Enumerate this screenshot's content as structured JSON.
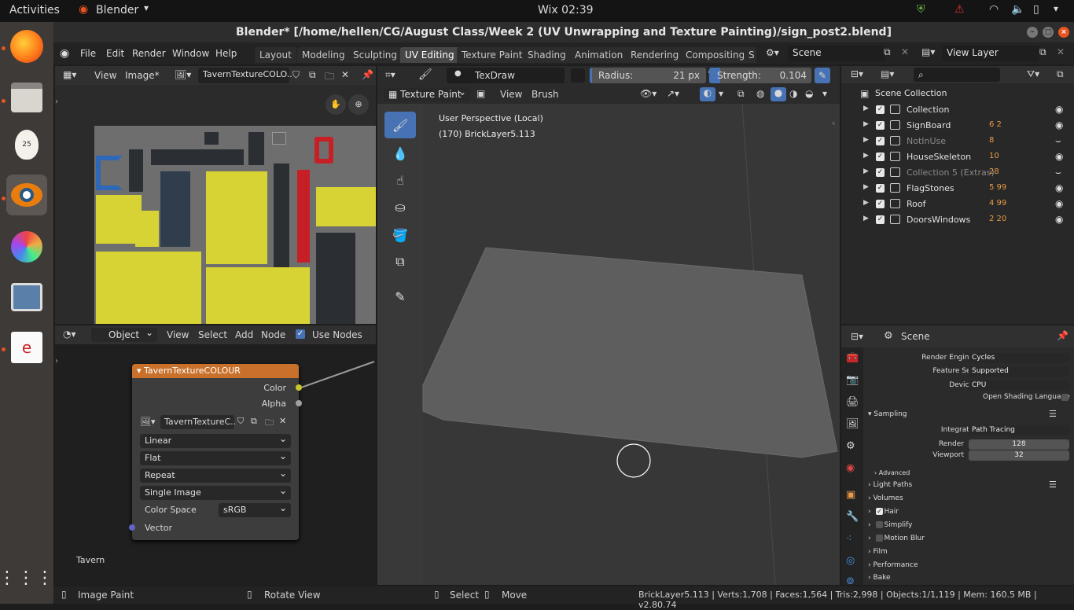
{
  "system": {
    "activities": "Activities",
    "app_menu": "Blender",
    "clock": "Wix 02:39"
  },
  "window": {
    "title": "Blender* [/home/hellen/CG/August Class/Week 2 (UV Unwrapping and Texture Painting)/sign_post2.blend]"
  },
  "menu": [
    "File",
    "Edit",
    "Render",
    "Window",
    "Help"
  ],
  "workspaces": [
    "Layout",
    "Modeling",
    "Sculpting",
    "UV Editing",
    "Texture Paint",
    "Shading",
    "Animation",
    "Rendering",
    "Compositing",
    "S"
  ],
  "active_workspace": "UV Editing",
  "scene": {
    "label": "Scene",
    "view_layer": "View Layer"
  },
  "image_editor": {
    "view": "View",
    "image": "Image*",
    "image_name": "TavernTextureCOLO.."
  },
  "node_editor": {
    "mode": "Object",
    "view": "View",
    "select": "Select",
    "add": "Add",
    "node": "Node",
    "use_nodes": "Use Nodes",
    "frame_label": "Tavern",
    "node_title": "TavernTextureCOLOUR",
    "out_color": "Color",
    "out_alpha": "Alpha",
    "image_field": "TavernTextureC..",
    "interpolation": "Linear",
    "projection": "Flat",
    "extension": "Repeat",
    "source": "Single Image",
    "color_space_label": "Color Space",
    "color_space": "sRGB",
    "in_vector": "Vector"
  },
  "viewport": {
    "brush_name": "TexDraw",
    "radius_label": "Radius:",
    "radius_value": "21 px",
    "strength_label": "Strength:",
    "strength_value": "0.104",
    "strength_fraction": 0.104,
    "mode": "Texture Paint",
    "view": "View",
    "brush": "Brush",
    "overlay_line1": "User Perspective (Local)",
    "overlay_line2": "(170) BrickLayer5.113"
  },
  "outliner": {
    "root": "Scene Collection",
    "items": [
      {
        "name": "Collection",
        "counts": "",
        "dim": false
      },
      {
        "name": "SignBoard",
        "counts": "6 2",
        "dim": false
      },
      {
        "name": "NotInUse",
        "counts": "8",
        "dim": true
      },
      {
        "name": "HouseSkeleton",
        "counts": "10",
        "dim": false
      },
      {
        "name": "Collection 5 (Extras)",
        "counts": "28",
        "dim": true
      },
      {
        "name": "FlagStones",
        "counts": "5 99",
        "dim": false
      },
      {
        "name": "Roof",
        "counts": "4 99",
        "dim": false
      },
      {
        "name": "DoorsWindows",
        "counts": "2 20",
        "dim": false
      }
    ]
  },
  "properties": {
    "title": "Scene",
    "render_engine_label": "Render Engine",
    "render_engine": "Cycles",
    "feature_set_label": "Feature Set",
    "feature_set": "Supported",
    "device_label": "Device",
    "device": "CPU",
    "osl": "Open Shading Language",
    "sampling": "Sampling",
    "integrator_label": "Integrator",
    "integrator": "Path Tracing",
    "render_label": "Render",
    "render_samples": "128",
    "viewport_label": "Viewport",
    "viewport_samples": "32",
    "advanced": "Advanced",
    "light_paths": "Light Paths",
    "volumes": "Volumes",
    "hair": "Hair",
    "simplify": "Simplify",
    "motion_blur": "Motion Blur",
    "film": "Film",
    "performance": "Performance",
    "bake": "Bake"
  },
  "statusbar": {
    "left": "Image Paint",
    "middle": "Rotate View",
    "select": "Select",
    "move": "Move",
    "stats": "BrickLayer5.113 | Verts:1,708 | Faces:1,564 | Tris:2,998 | Objects:1/1,119 | Mem: 160.5 MB | v2.80.74"
  },
  "colors": {
    "accent": "#4772b3",
    "node_header": "#c9712b",
    "uv_yellow": "#d7d334",
    "uv_blue": "#2e68b8",
    "uv_red": "#c62026"
  }
}
